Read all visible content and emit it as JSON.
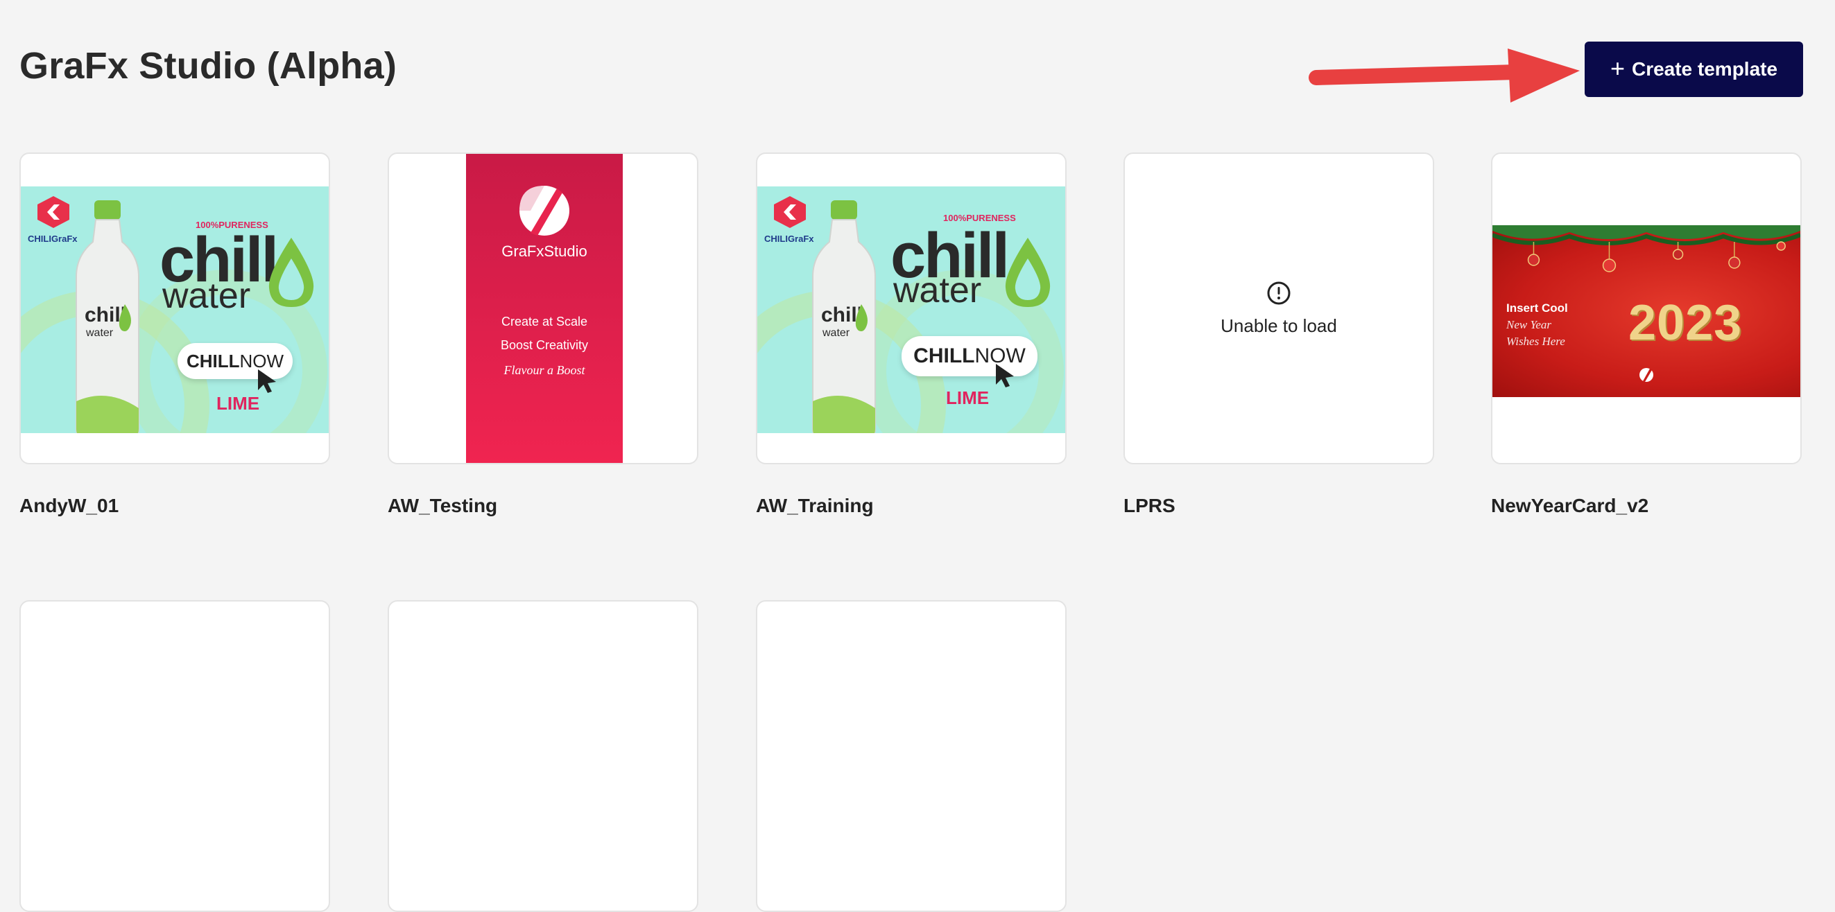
{
  "page": {
    "title": "GraFx Studio (Alpha)"
  },
  "toolbar": {
    "create_label": "Create template",
    "create_icon": "plus-icon"
  },
  "accent_colors": {
    "button": "#0a0a4a",
    "arrow": "#e84040"
  },
  "templates": [
    {
      "name": "AndyW_01",
      "thumbnail": {
        "type": "chill-water",
        "purity": "100%PURENESS",
        "brand_a": "chill",
        "brand_b": "water",
        "cta_bold": "CHILL",
        "cta_rest": "NOW",
        "flavour": "LIME",
        "logo_text": "CHILIGraFx"
      }
    },
    {
      "name": "AW_Testing",
      "thumbnail": {
        "type": "grafx-studio",
        "brand": "GraFxStudio",
        "line1": "Create at Scale",
        "line2": "Boost Creativity",
        "line3": "Flavour a Boost"
      }
    },
    {
      "name": "AW_Training",
      "thumbnail": {
        "type": "chill-water",
        "purity": "100%PURENESS",
        "brand_a": "chill",
        "brand_b": "water",
        "cta_bold": "CHILL",
        "cta_rest": "NOW",
        "flavour": "LIME",
        "logo_text": "CHILIGraFx"
      }
    },
    {
      "name": "LPRS",
      "thumbnail": {
        "type": "error",
        "message": "Unable to load",
        "icon": "alert-circle-icon"
      }
    },
    {
      "name": "NewYearCard_v2",
      "thumbnail": {
        "type": "new-year",
        "line1": "Insert Cool",
        "line2": "New Year",
        "line3": "Wishes Here",
        "year": "2023"
      }
    },
    {
      "name": "",
      "thumbnail": {
        "type": "blank"
      }
    },
    {
      "name": "",
      "thumbnail": {
        "type": "blank"
      }
    },
    {
      "name": "",
      "thumbnail": {
        "type": "blank"
      }
    }
  ]
}
